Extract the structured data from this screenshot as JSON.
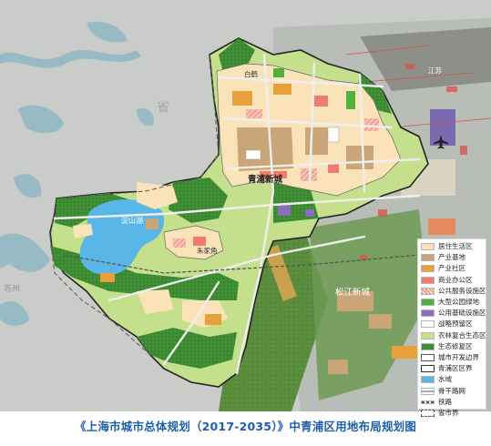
{
  "map": {
    "places": {
      "baihe": "白鹤",
      "qingpu_new_city": "青浦新城",
      "dianshan_lake": "淀山湖",
      "zhujiajiao": "朱家角",
      "songjiang_new_city": "松江新城",
      "jiangsu_faint": "江苏",
      "province_faint": "省",
      "suzhou_faint": "苏州"
    },
    "airport_icon": "airplane-icon"
  },
  "legend": {
    "items": [
      {
        "label": "居住生活区",
        "color": "#fbe3b9",
        "pattern": "solid"
      },
      {
        "label": "产业基地",
        "color": "#c9a577",
        "pattern": "solid"
      },
      {
        "label": "产业社区",
        "color": "#e8a13a",
        "pattern": "solid"
      },
      {
        "label": "商业办公区",
        "color": "#f07b6e",
        "pattern": "solid"
      },
      {
        "label": "公共服务设施区",
        "color": "#f39a8d",
        "pattern": "hatch"
      },
      {
        "label": "大型公园绿地",
        "color": "#4fb03c",
        "pattern": "solid"
      },
      {
        "label": "公用基础设施区",
        "color": "#8a6dbf",
        "pattern": "solid"
      },
      {
        "label": "战略预留区",
        "color": "#ffffff",
        "pattern": "solid"
      },
      {
        "label": "农林复合生态区",
        "color": "#c5e08c",
        "pattern": "solid"
      },
      {
        "label": "生态修复区",
        "color": "#3c8d33",
        "pattern": "solid"
      },
      {
        "label": "城市开发边界",
        "color": "#555555",
        "pattern": "outline"
      },
      {
        "label": "青浦区区界",
        "color": "#333333",
        "pattern": "outline"
      },
      {
        "label": "水域",
        "color": "#58b7e6",
        "pattern": "solid"
      },
      {
        "label": "骨干路网",
        "color": "#aaaaaa",
        "pattern": "road"
      },
      {
        "label": "铁路",
        "color": "#555555",
        "pattern": "rail"
      },
      {
        "label": "省市界",
        "color": "#555555",
        "pattern": "dashed"
      }
    ]
  },
  "caption": "《上海市城市总体规划（2017-2035）》中青浦区用地布局规划图"
}
